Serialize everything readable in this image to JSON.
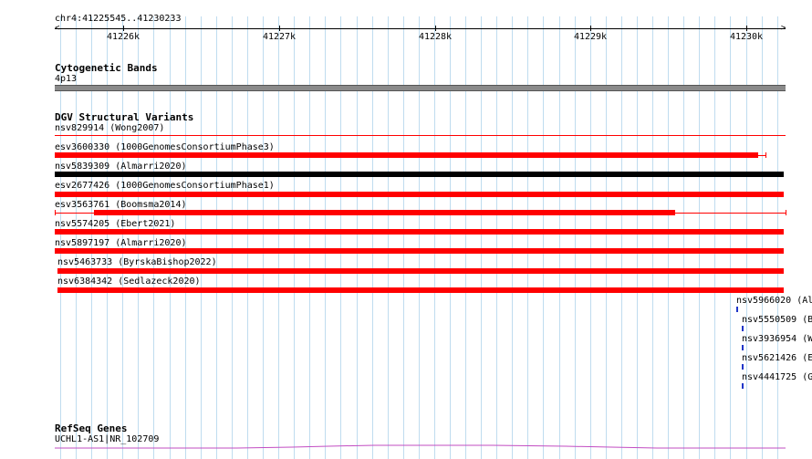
{
  "ruler": {
    "position": "chr4:41225545..41230233",
    "ticks": [
      "41226k",
      "41227k",
      "41228k",
      "41229k",
      "41230k"
    ]
  },
  "cytoband": {
    "title": "Cytogenetic Bands",
    "band_label": "4p13",
    "band_color": "#8a8a8a"
  },
  "dgv": {
    "title": "DGV Structural Variants",
    "colors": {
      "red": "#ff0000",
      "black": "#000000",
      "blue": "#1f35c8"
    },
    "variants": [
      {
        "label": "nsv829914 (Wong2007)"
      },
      {
        "label": "esv3600330 (1000GenomesConsortiumPhase3)"
      },
      {
        "label": "nsv5839309 (Almarri2020)"
      },
      {
        "label": "esv2677426 (1000GenomesConsortiumPhase1)"
      },
      {
        "label": "esv3563761 (Boomsma2014)"
      },
      {
        "label": "nsv5574205 (Ebert2021)"
      },
      {
        "label": "nsv5897197 (Almarri2020)"
      },
      {
        "label": "nsv5463733 (ByrskaBishop2022)"
      },
      {
        "label": "nsv6384342 (Sedlazeck2020)"
      }
    ],
    "clipped_variants": [
      {
        "label": "nsv5966020 (Al"
      },
      {
        "label": "nsv5550509 (B"
      },
      {
        "label": "nsv3936954 (W"
      },
      {
        "label": "nsv5621426 (E"
      },
      {
        "label": "nsv4441725 (G"
      }
    ]
  },
  "refseq": {
    "title": "RefSeq Genes",
    "gene_label": "UCHL1-AS1|NR_102709",
    "gene_color": "#c24cc2"
  }
}
